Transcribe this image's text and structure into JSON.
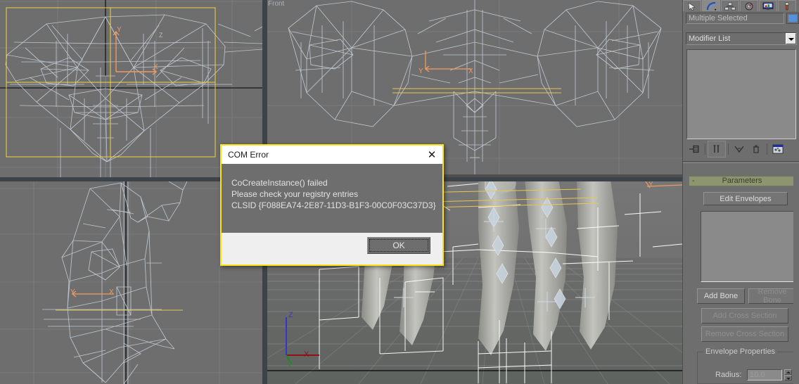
{
  "app": {
    "background": "#6e6e6e",
    "viewport_bg": "#6e6e6e",
    "wire_color": "#c2ccd6",
    "accent_yellow": "#ffe11a"
  },
  "viewports": [
    {
      "name": "top-left-viewport",
      "label": ""
    },
    {
      "name": "top-right-viewport",
      "label": "Front"
    },
    {
      "name": "bottom-left-viewport",
      "label": ""
    },
    {
      "name": "bottom-right-viewport",
      "label": ""
    }
  ],
  "dialog": {
    "title": "COM Error",
    "close_icon": "✕",
    "lines": [
      "CoCreateInstance() failed",
      "Please check your registry entries",
      "CLSID {F088EA74-2E87-11D3-B1F3-00C0F03C37D3}"
    ],
    "ok_label": "OK",
    "border_color": "#ffe11a"
  },
  "command_panel": {
    "tabs": [
      {
        "name": "create-tab",
        "icon": "create-arrow-icon",
        "selected": false
      },
      {
        "name": "modify-tab",
        "icon": "modify-bend-icon",
        "selected": true
      },
      {
        "name": "hierarchy-tab",
        "icon": "hierarchy-icon",
        "selected": false
      },
      {
        "name": "motion-tab",
        "icon": "motion-wheel-icon",
        "selected": false
      },
      {
        "name": "display-tab",
        "icon": "display-monitor-icon",
        "selected": false
      },
      {
        "name": "utilities-tab",
        "icon": "utilities-hammer-icon",
        "selected": false
      }
    ],
    "object_name": "Multiple Selected",
    "object_color": "#5591e0",
    "modifier_list_label": "Modifier List",
    "stack_buttons": [
      {
        "name": "pin-stack-button",
        "icon": "pin-stack-icon",
        "enabled": true
      },
      {
        "name": "show-end-result-button",
        "icon": "show-end-result-icon",
        "enabled": true
      },
      {
        "name": "make-unique-button",
        "icon": "make-unique-icon",
        "enabled": true
      },
      {
        "name": "remove-modifier-button",
        "icon": "trash-icon",
        "enabled": true
      },
      {
        "name": "configure-sets-button",
        "icon": "configure-sets-icon",
        "enabled": true
      }
    ],
    "rollout": {
      "title": "Parameters",
      "collapse_icon": "-",
      "edit_envelopes_label": "Edit Envelopes",
      "add_bone_label": "Add Bone",
      "remove_bone_label": "Remove Bone",
      "add_cross_section_label": "Add Cross Section",
      "remove_cross_section_label": "Remove Cross Section",
      "envelope_properties_title": "Envelope Properties",
      "radius_label": "Radius:",
      "radius_value": "10.0"
    }
  }
}
